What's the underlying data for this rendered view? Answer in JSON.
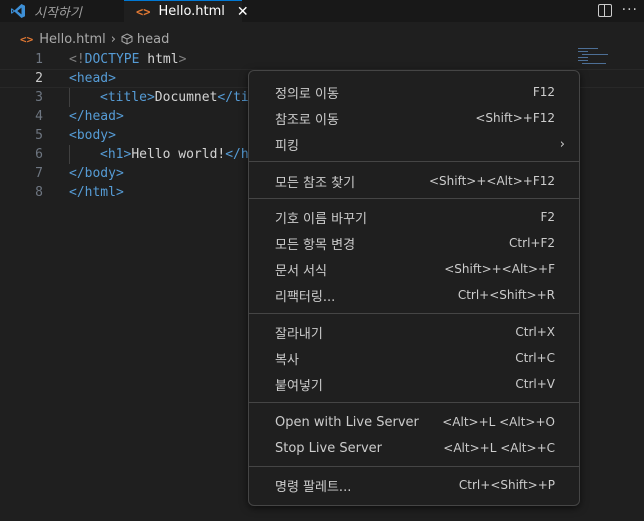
{
  "tabs": [
    {
      "label": "시작하기",
      "icon": "vscode-icon"
    },
    {
      "label": "Hello.html",
      "icon": "html-file-icon",
      "close": "✕"
    }
  ],
  "tab_actions": {
    "split": "split-editor-icon",
    "more": "···"
  },
  "breadcrumb": {
    "file": "Hello.html",
    "symbol": "head",
    "sep": "›"
  },
  "editor": {
    "current_line": 2,
    "lines": [
      {
        "n": "1"
      },
      {
        "n": "2"
      },
      {
        "n": "3"
      },
      {
        "n": "4"
      },
      {
        "n": "5"
      },
      {
        "n": "6"
      },
      {
        "n": "7"
      },
      {
        "n": "8"
      }
    ],
    "code": {
      "l1_open": "<!",
      "l1_doctype": "DOCTYPE",
      "l1_html": " html",
      "l1_close": ">",
      "l2": "<head>",
      "l3_open": "<title>",
      "l3_text": "Documnet",
      "l3_close": "</tit",
      "l4": "</head>",
      "l5": "<body>",
      "l6_open": "<h1>",
      "l6_text": "Hello world!",
      "l6_close": "</h",
      "l7": "</body>",
      "l8": "</html>"
    }
  },
  "context_menu": {
    "items": [
      {
        "label": "정의로 이동",
        "key": "F12"
      },
      {
        "label": "참조로 이동",
        "key": "<Shift>+F12"
      },
      {
        "label": "피킹",
        "key": "",
        "submenu": "›"
      },
      {
        "label": "모든 참조 찾기",
        "key": "<Shift>+<Alt>+F12"
      },
      {
        "label": "기호 이름 바꾸기",
        "key": "F2"
      },
      {
        "label": "모든 항목 변경",
        "key": "Ctrl+F2"
      },
      {
        "label": "문서 서식",
        "key": "<Shift>+<Alt>+F"
      },
      {
        "label": "리팩터링...",
        "key": "Ctrl+<Shift>+R"
      },
      {
        "label": "잘라내기",
        "key": "Ctrl+X"
      },
      {
        "label": "복사",
        "key": "Ctrl+C"
      },
      {
        "label": "붙여넣기",
        "key": "Ctrl+V"
      },
      {
        "label": "Open with Live Server",
        "key": "<Alt>+L <Alt>+O"
      },
      {
        "label": "Stop Live Server",
        "key": "<Alt>+L <Alt>+C"
      },
      {
        "label": "명령 팔레트...",
        "key": "Ctrl+<Shift>+P"
      }
    ]
  },
  "colors": {
    "accent": "#0078d4",
    "html_icon": "#e37933",
    "tag": "#569cd6",
    "bracket": "#808080"
  }
}
